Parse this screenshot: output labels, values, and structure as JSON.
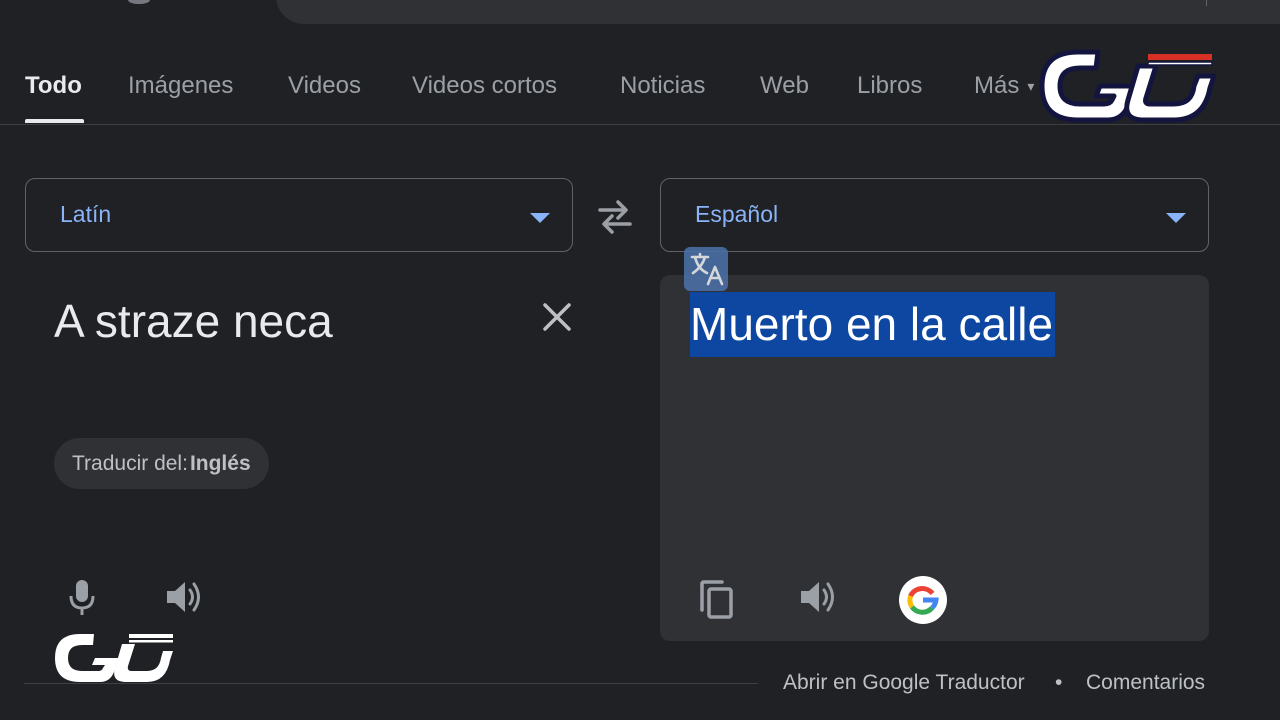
{
  "tabs": [
    {
      "label": "Todo",
      "active": true
    },
    {
      "label": "Imágenes"
    },
    {
      "label": "Videos"
    },
    {
      "label": "Videos cortos"
    },
    {
      "label": "Noticias"
    },
    {
      "label": "Web"
    },
    {
      "label": "Libros"
    },
    {
      "label": "Más"
    }
  ],
  "translator": {
    "source_language": "Latín",
    "target_language": "Español",
    "source_text": "A straze neca",
    "translated_text": "Muerto en la calle",
    "detect_chip": {
      "prefix": "Traducir del:",
      "language": "Inglés"
    }
  },
  "footer": {
    "open_link": "Abrir en Google Traductor",
    "separator": "•",
    "feedback_link": "Comentarios"
  },
  "colors": {
    "background": "#202124",
    "accent": "#8ab4f8",
    "selection": "#0d47a1",
    "card": "#303134"
  },
  "icons": [
    "swap-arrows-icon",
    "close-icon",
    "microphone-icon",
    "speaker-icon",
    "copy-icon",
    "google-g-icon",
    "translate-icon",
    "watermark-logo"
  ]
}
